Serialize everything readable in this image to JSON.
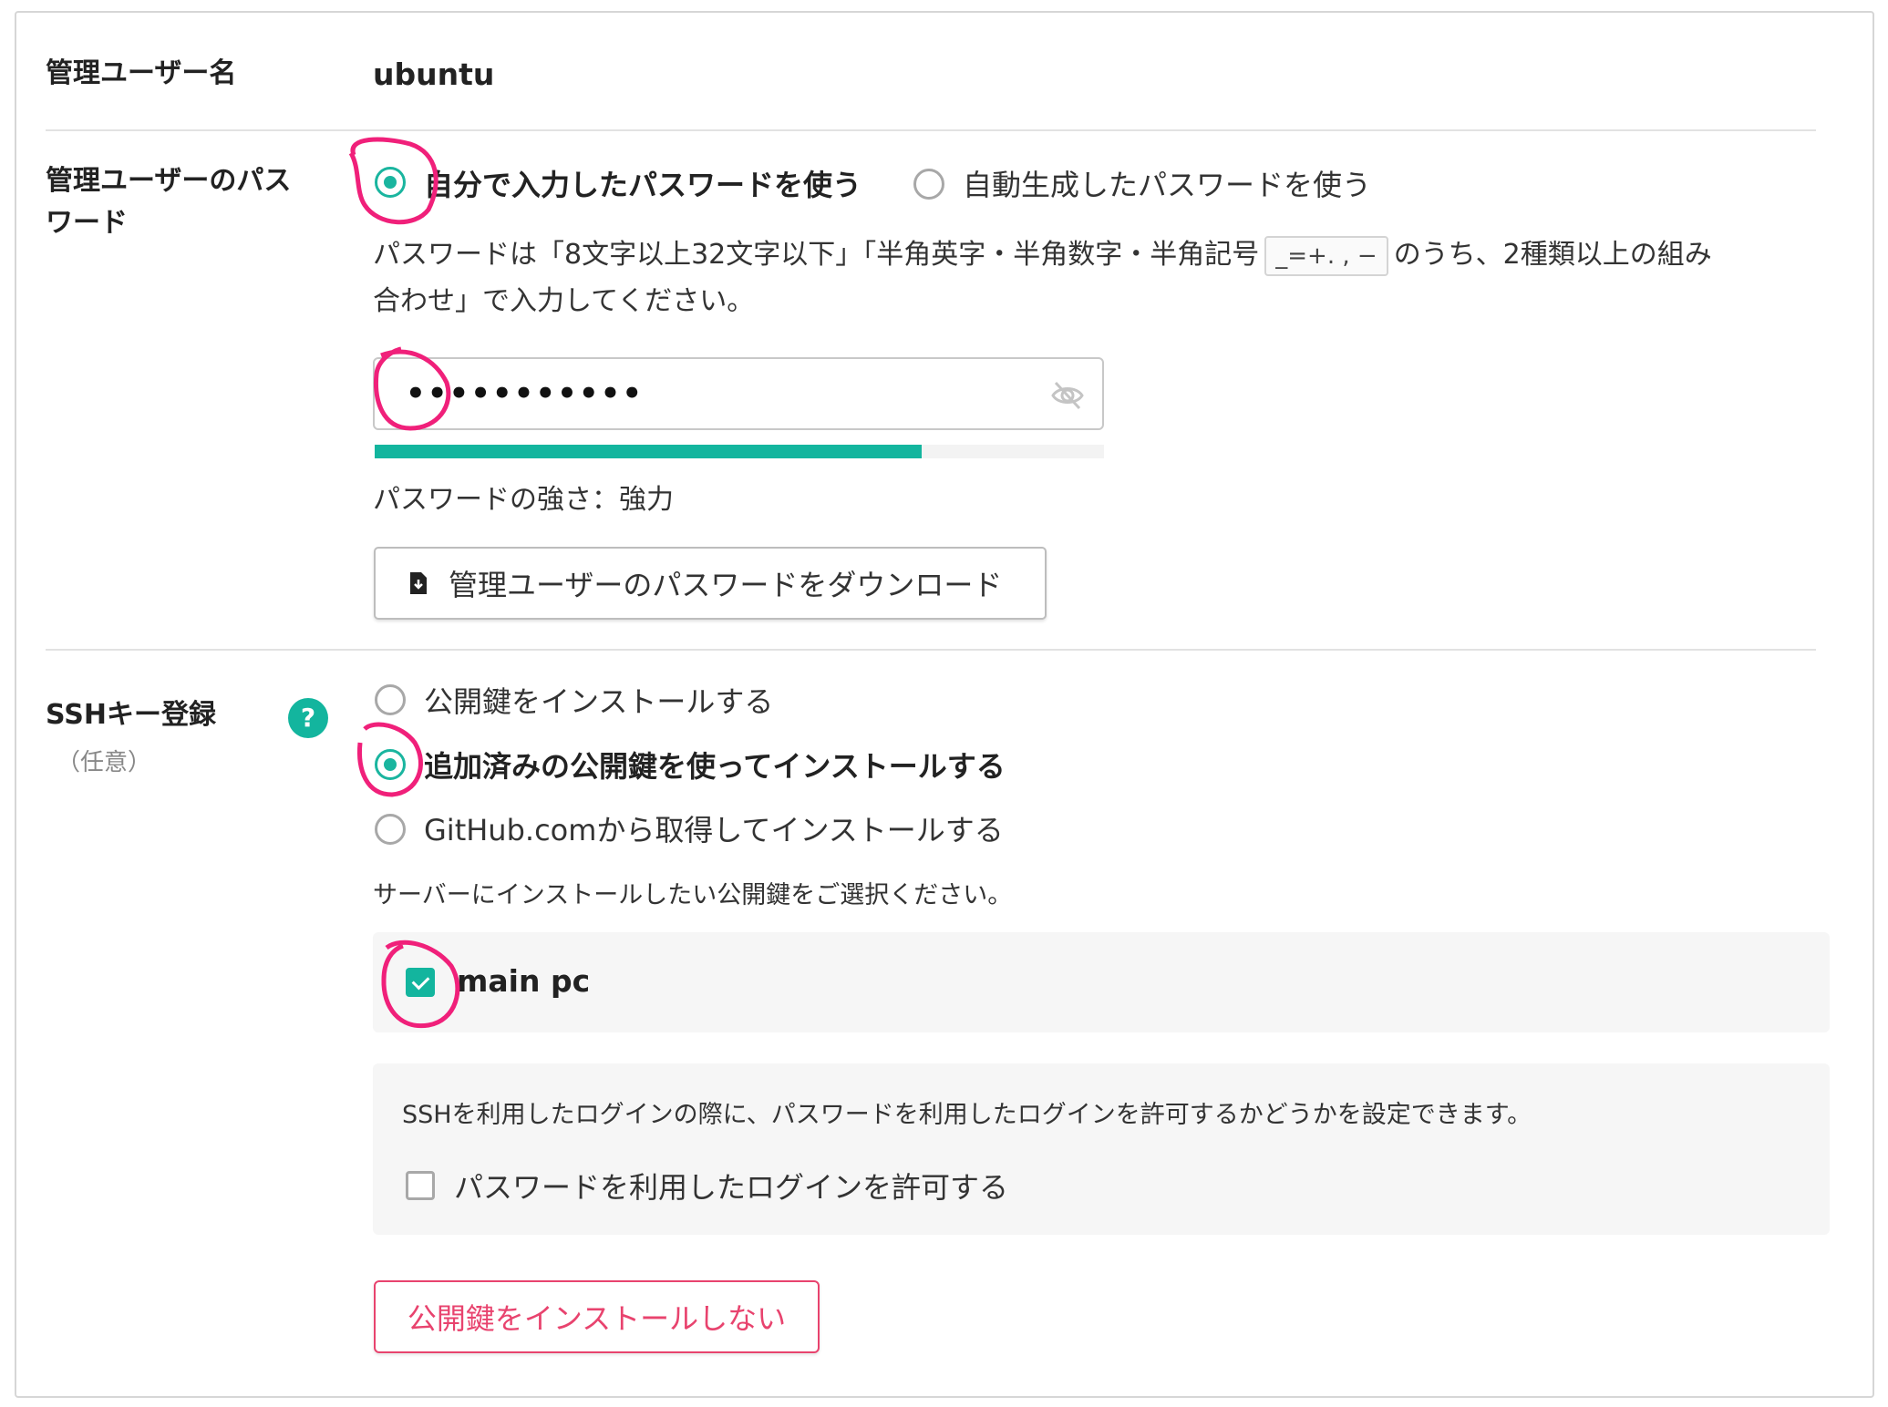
{
  "admin_user": {
    "label": "管理ユーザー名",
    "value": "ubuntu"
  },
  "admin_password": {
    "label_line1": "管理ユーザーのパス",
    "label_line2": "ワード",
    "options": [
      {
        "label": "自分で入力したパスワードを使う",
        "checked": true
      },
      {
        "label": "自動生成したパスワードを使う",
        "checked": false
      }
    ],
    "help_part1": "パスワードは「8文字以上32文字以下」「半角英字・半角数字・半角記号",
    "help_symbols": "_=+. , −",
    "help_part2": "のうち、2種類以上の組み",
    "help_line2": "合わせ」で入力してください。",
    "masked_value": "•••••••••••",
    "strength_fraction": 0.75,
    "strength_text": "パスワードの強さ：強力",
    "download_button": "管理ユーザーのパスワードをダウンロード"
  },
  "ssh": {
    "label": "SSHキー登録",
    "sublabel": "（任意）",
    "help_icon": "?",
    "options": [
      {
        "label": "公開鍵をインストールする",
        "checked": false
      },
      {
        "label": "追加済みの公開鍵を使ってインストールする",
        "checked": true
      },
      {
        "label": "GitHub.comから取得してインストールする",
        "checked": false
      }
    ],
    "select_prompt": "サーバーにインストールしたい公開鍵をご選択ください。",
    "keys": [
      {
        "name": "main pc",
        "checked": true
      }
    ],
    "login_info": "SSHを利用したログインの際に、パスワードを利用したログインを許可するかどうかを設定できます。",
    "allow_password_login": {
      "label": "パスワードを利用したログインを許可する",
      "checked": false
    },
    "skip_button": "公開鍵をインストールしない"
  },
  "colors": {
    "accent": "#13b59e",
    "danger": "#e8436e",
    "annotation": "#f0207a"
  },
  "icons": {
    "password_visibility": "eye-slash-icon",
    "download": "file-download-icon",
    "help": "question-circle-icon"
  }
}
